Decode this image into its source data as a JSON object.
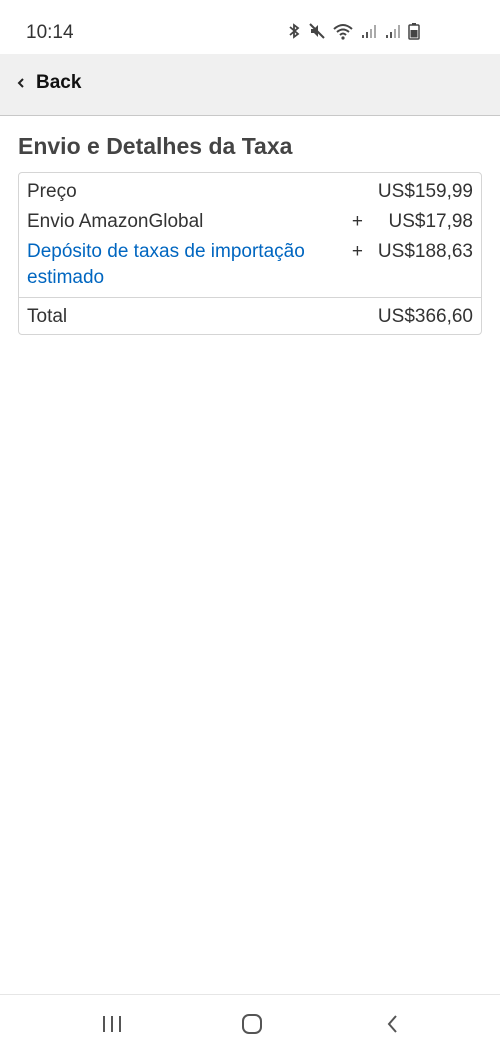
{
  "status_bar": {
    "time": "10:14",
    "icons": [
      "bluetooth-icon",
      "mute-icon",
      "wifi-icon",
      "signal-icon",
      "signal-icon",
      "battery-icon"
    ]
  },
  "nav": {
    "back_label": "Back"
  },
  "page": {
    "title": "Envio e Detalhes da Taxa"
  },
  "fees": {
    "price": {
      "label": "Preço",
      "sign": "",
      "amount": "US$159,99"
    },
    "shipping": {
      "label": "Envio AmazonGlobal",
      "sign": "+",
      "amount": "US$17,98"
    },
    "deposit": {
      "label": "Depósito de taxas de importação estimado",
      "sign": "+",
      "amount": "US$188,63"
    },
    "total": {
      "label": "Total",
      "amount": "US$366,60"
    }
  },
  "colors": {
    "link": "#0066c0",
    "nav_bg": "#f0f0f0",
    "text": "#333333"
  },
  "system_nav": {
    "icons": [
      "recent-apps-icon",
      "home-icon",
      "back-icon"
    ]
  }
}
